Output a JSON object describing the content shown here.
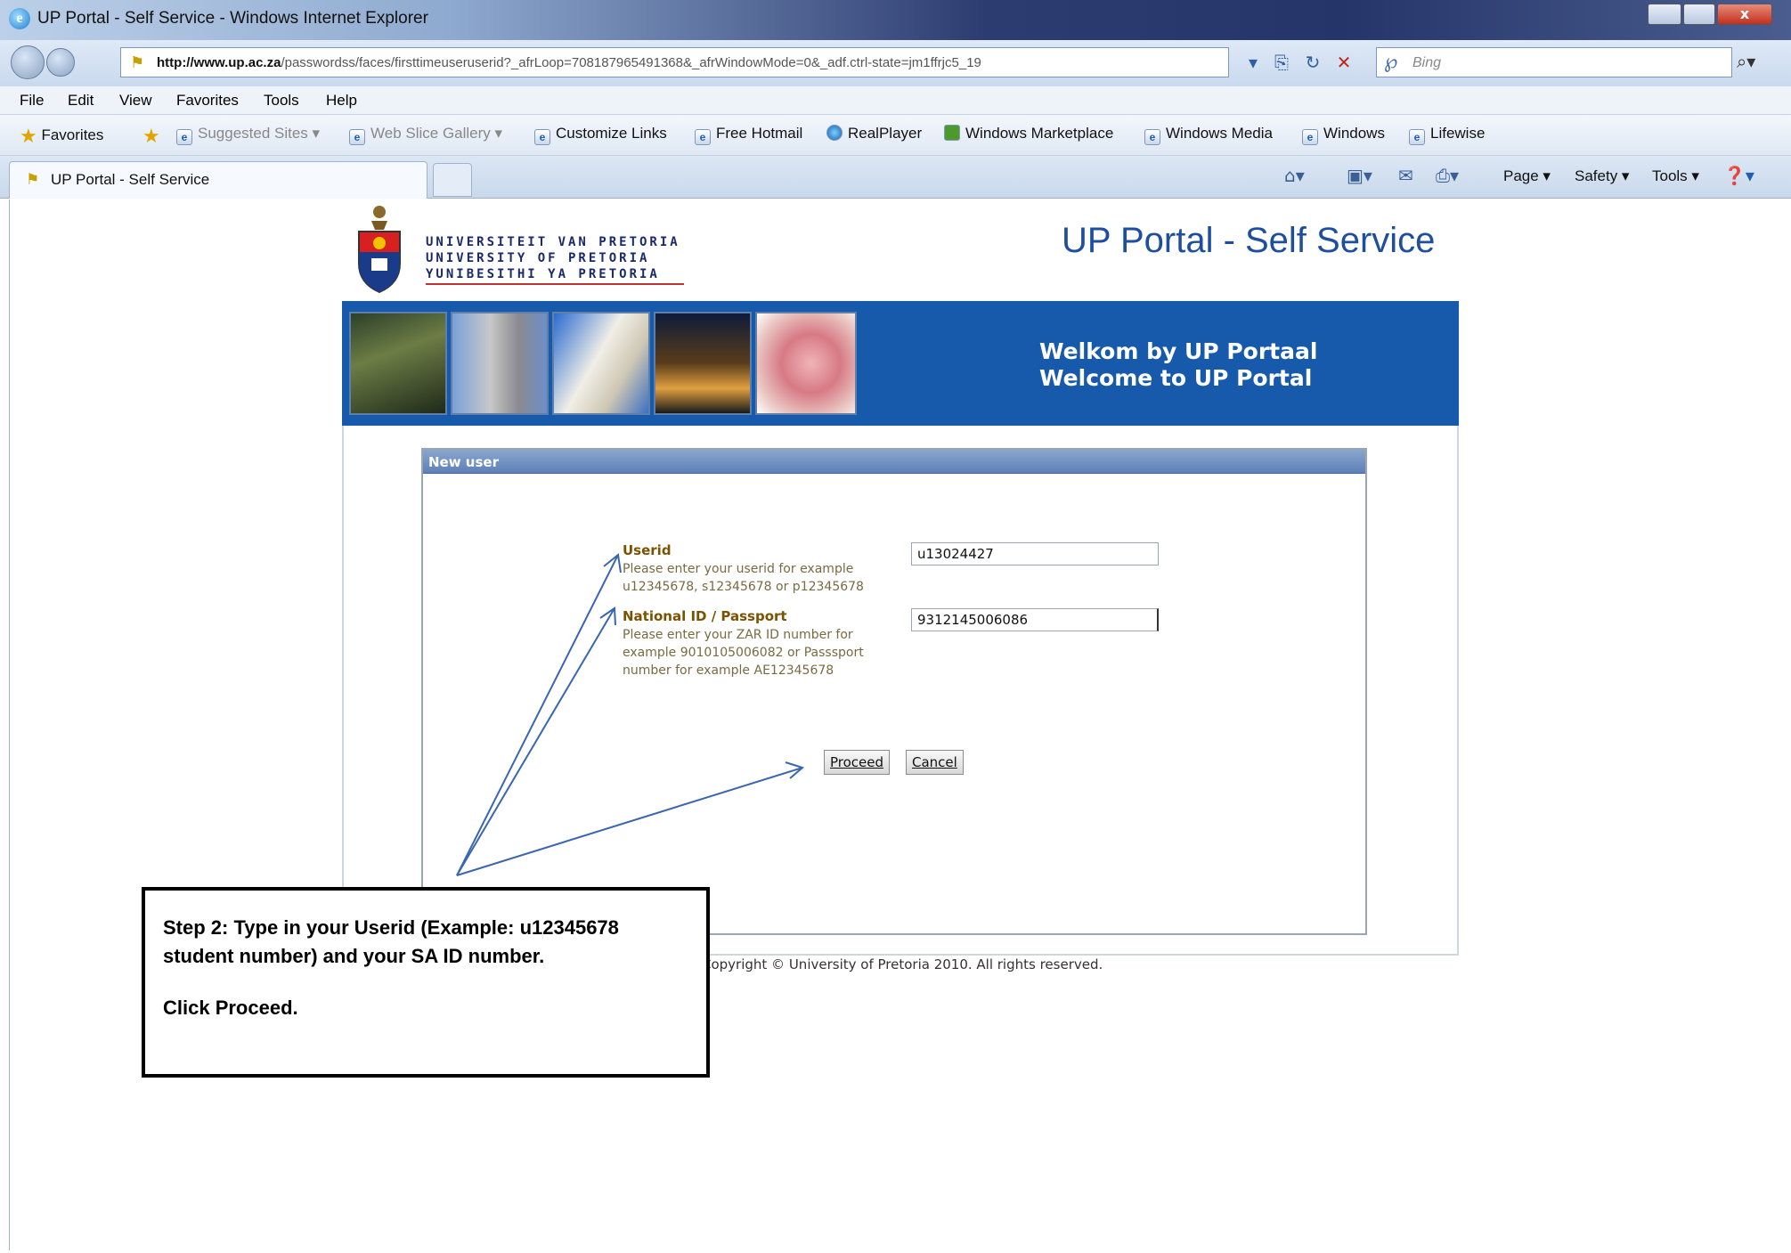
{
  "window": {
    "title": "UP Portal - Self Service - Windows Internet Explorer",
    "close_glyph": "x"
  },
  "address_bar": {
    "url_domain": "http://www.up.ac.za",
    "url_path": "/passwordss/faces/firsttimeuseruserid?_afrLoop=708187965491368&_afrWindowMode=0&_adf.ctrl-state=jm1ffrjc5_19",
    "search_placeholder": "Bing"
  },
  "menu": [
    "File",
    "Edit",
    "View",
    "Favorites",
    "Tools",
    "Help"
  ],
  "favorites_bar": {
    "favorites_label": "Favorites",
    "items": [
      "Suggested Sites ▾",
      "Web Slice Gallery ▾",
      "Customize Links",
      "Free Hotmail",
      "RealPlayer",
      "Windows Marketplace",
      "Windows Media",
      "Windows",
      "Lifewise"
    ]
  },
  "tab": {
    "label": "UP Portal - Self Service"
  },
  "command_bar": {
    "page": "Page ▾",
    "safety": "Safety ▾",
    "tools": "Tools ▾"
  },
  "header": {
    "logo_lines": [
      "UNIVERSITEIT VAN PRETORIA",
      "UNIVERSITY OF PRETORIA",
      "YUNIBESITHI YA PRETORIA"
    ],
    "portal_title": "UP Portal - Self Service"
  },
  "banner": {
    "welcome_af": "Welkom by UP Portaal",
    "welcome_en": "Welcome to UP Portal"
  },
  "form": {
    "panel_title": "New user",
    "userid_label": "Userid",
    "userid_help_1": "Please enter your userid for example",
    "userid_help_2": "u12345678, s12345678 or p12345678",
    "userid_value": "u13024427",
    "nid_label": "National ID / Passport",
    "nid_help_1": "Please enter your ZAR ID number for",
    "nid_help_2": "example 9010105006082 or Passsport",
    "nid_help_3": "number for example AE12345678",
    "nid_value": "9312145006086",
    "proceed_label": "Proceed",
    "cancel_label": "Cancel"
  },
  "footer": {
    "copyright": "Copyright © University of Pretoria 2010. All rights reserved."
  },
  "callout": {
    "line1": "Step 2:  Type in your Userid (Example:  u12345678",
    "line2": "student number) and your SA ID number.",
    "line3": "Click Proceed."
  },
  "colors": {
    "banner": "#175aab",
    "title": "#1e4f9e",
    "label": "#7a5200",
    "arrow": "#3a66b0"
  }
}
